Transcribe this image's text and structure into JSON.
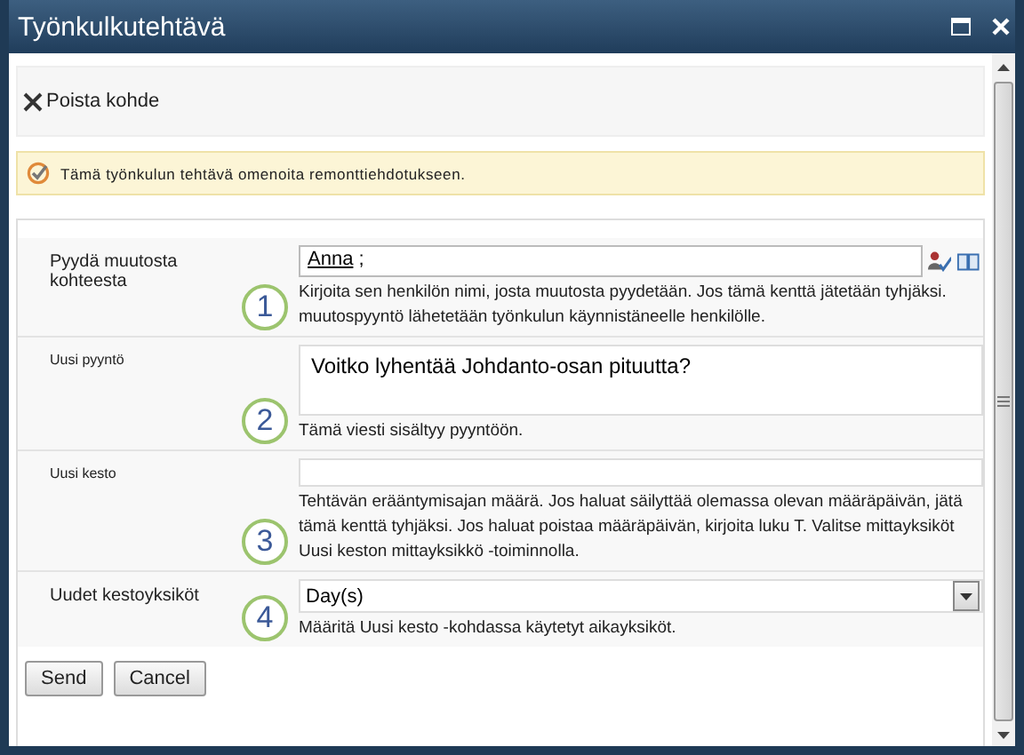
{
  "window": {
    "title": "Työnkulkutehtävä"
  },
  "toolbar": {
    "delete_label": "Poista kohde"
  },
  "notice": "Tämä työnkulun tehtävä omenoita remonttiehdotukseen.",
  "rows": [
    {
      "kind": "people",
      "label": "Pyydä muutosta kohteesta",
      "value": "Anna",
      "separator": ";",
      "callout": "1",
      "description": "Kirjoita sen henkilön nimi, josta muutosta pyydetään. Jos tämä kenttä jätetään tyhjäksi. muutospyyntö lähetetään työnkulun käynnistäneelle henkilölle."
    },
    {
      "kind": "multiline",
      "label": "Uusi pyyntö",
      "value": "Voitko lyhentää Johdanto-osan pituutta?",
      "callout": "2",
      "description": "Tämä viesti sisältyy pyyntöön."
    },
    {
      "kind": "text",
      "label": "Uusi kesto",
      "callout": "3",
      "description": "Tehtävän erääntymisajan määrä. Jos haluat säilyttää olemassa olevan määräpäivän, jätä tämä kenttä tyhjäksi. Jos haluat poistaa määräpäivän, kirjoita luku T. Valitse mittayksiköt Uusi keston mittayksikkö -toiminnolla."
    },
    {
      "kind": "select",
      "label": "Uudet kestoyksiköt",
      "value": "Day(s)",
      "callout": "4",
      "description": "Määritä Uusi kesto -kohdassa käytetyt aikayksiköt."
    }
  ],
  "buttons": [
    "Send",
    "Cancel"
  ]
}
